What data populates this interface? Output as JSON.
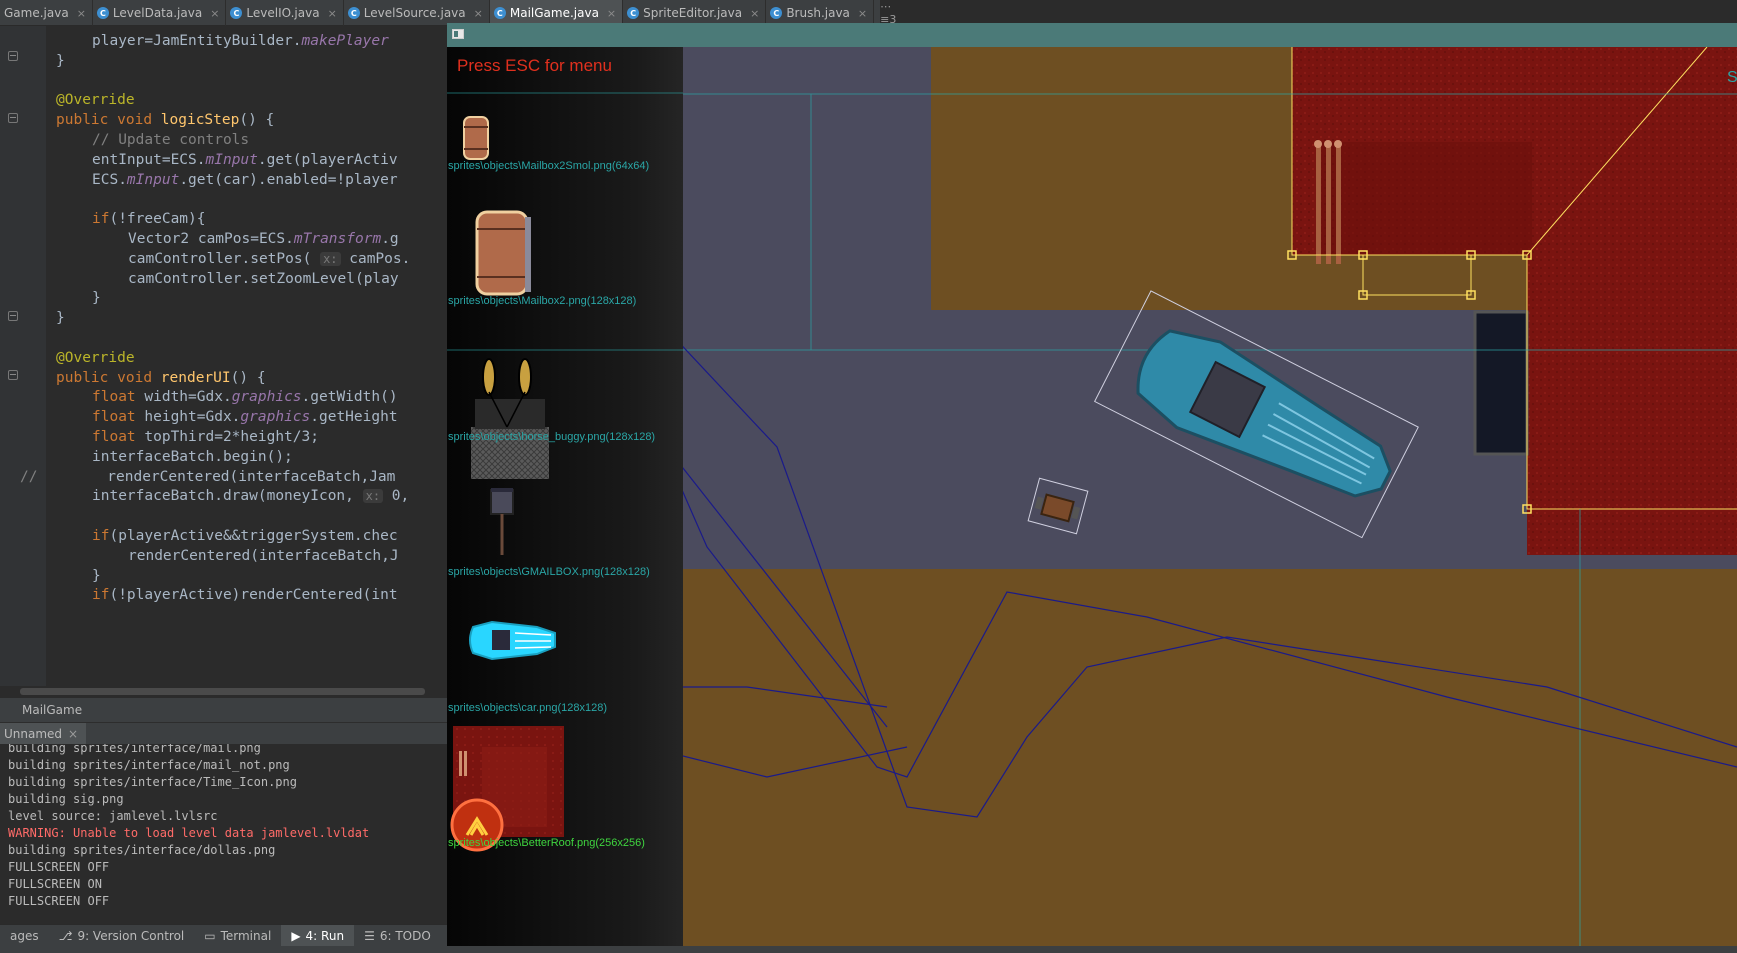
{
  "ide": {
    "tabs": [
      {
        "label": "Game.java",
        "icon": "class-icon",
        "active": false
      },
      {
        "label": "LevelData.java",
        "icon": "class-icon",
        "active": false
      },
      {
        "label": "LevelIO.java",
        "icon": "class-icon",
        "active": false
      },
      {
        "label": "LevelSource.java",
        "icon": "class-icon",
        "active": false
      },
      {
        "label": "MailGame.java",
        "icon": "class-icon",
        "active": true
      },
      {
        "label": "SpriteEditor.java",
        "icon": "class-icon",
        "active": false
      },
      {
        "label": "Brush.java",
        "icon": "class-icon",
        "active": false
      }
    ],
    "tabs_overflow": "⋯≡3",
    "code_lines": [
      "player=JamEntityBuilder.makePlayer",
      "}",
      "",
      "@Override",
      "public void logicStep() {",
      "// Update controls",
      "entInput=ECS.mInput.get(playerActiv",
      "ECS.mInput.get(car).enabled=!player",
      "",
      "if(!freeCam){",
      "Vector2 camPos=ECS.mTransform.g",
      "camController.setPos( x: camPos.",
      "camController.setZoomLevel(play",
      "}",
      "}",
      "",
      "@Override",
      "public void renderUI() {",
      "float width=Gdx.graphics.getWidth()",
      "float height=Gdx.graphics.getHeight",
      "float topThird=2*height/3;",
      "interfaceBatch.begin();",
      "//        renderCentered(interfaceBatch,Jam",
      "interfaceBatch.draw(moneyIcon, x: 0,",
      "",
      "if(playerActive&&triggerSystem.chec",
      "renderCentered(interfaceBatch,J",
      "}",
      "if(!playerActive)renderCentered(int"
    ],
    "run_title": "MailGame",
    "run_tab": "Unnamed",
    "console": [
      "building sprites/interface/mail.png",
      "building sprites/interface/mail_not.png",
      "building sprites/interface/Time_Icon.png",
      "building sig.png",
      "level source: jamlevel.lvlsrc",
      "WARNING: Unable to load level data jamlevel.lvldat",
      "building sprites/interface/dollas.png",
      "FULLSCREEN OFF",
      "FULLSCREEN ON",
      "FULLSCREEN OFF"
    ],
    "bottom_tabs": {
      "messages": "ages",
      "version_control": "9: Version Control",
      "terminal": "Terminal",
      "run": "4: Run",
      "todo": "6: TODO"
    }
  },
  "game": {
    "esc_hint": "Press ESC for menu",
    "palette": [
      {
        "label": "sprites\\objects\\Mailbox2Smol.png(64x64)",
        "selected": false
      },
      {
        "label": "sprites\\objects\\Mailbox2.png(128x128)",
        "selected": false
      },
      {
        "label": "sprites\\objects\\horse_buggy.png(128x128)",
        "selected": false
      },
      {
        "label": "sprites\\objects\\GMAILBOX.png(128x128)",
        "selected": false
      },
      {
        "label": "sprites\\objects\\car.png(128x128)",
        "selected": false
      },
      {
        "label": "sprites\\objects\\BetterRoof.png(256x256)",
        "selected": true
      }
    ],
    "edge_letter": "S",
    "colors": {
      "road": "#4b4b5e",
      "dirt": "#6e4f22",
      "dirt_dark": "#5f4420",
      "roof": "#7a1410",
      "car": "#2f8aa8",
      "selection": "#ffe060",
      "path": "#1a1a8a",
      "accent_text": "#2aa6a6",
      "esc_text": "#e0301e"
    }
  }
}
